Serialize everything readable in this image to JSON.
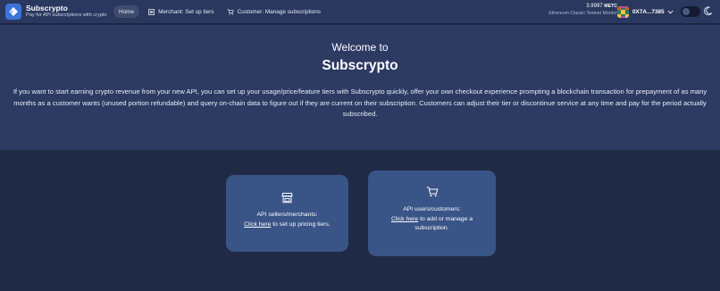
{
  "header": {
    "brand_name": "Subscrypto",
    "brand_tagline": "Pay for API subscriptions with crypto",
    "nav": [
      {
        "label": "Home",
        "icon": "none"
      },
      {
        "label": "Merchant: Set up tiers",
        "icon": "list-icon"
      },
      {
        "label": "Customer: Manage subscriptions",
        "icon": "cart-icon"
      }
    ],
    "balance_amount": "3.9997",
    "balance_unit": "METC",
    "network": "Ethereum Classic Testnet Mordor",
    "address": "0X7A...7385"
  },
  "hero": {
    "welcome": "Welcome to",
    "title": "Subscrypto",
    "description": "If you want to start earning crypto revenue from your new API, you can set up your usage/price/feature tiers with Subscrypto quickly, offer your own checkout experience prompting a blockchain transaction for prepayment of as many months as a customer wants (unused portion refundable) and query on-chain data to figure out if they are current on their subscription. Customers can adjust their tier or discontinue service at any time and pay for the period actually subscribed."
  },
  "cards": {
    "merchant": {
      "icon": "store-icon",
      "heading": "API sellers/merchants:",
      "link": "Click here",
      "rest": " to set up pricing tiers."
    },
    "customer": {
      "icon": "cart-icon",
      "heading": "API users/customers:",
      "link": "Click here",
      "rest": " to add or manage a subscription."
    }
  },
  "colors": {
    "header_bg": "#2a385f",
    "hero_bg": "#2d3b63",
    "page_bg": "#202a45",
    "card_bg": "#395487",
    "accent": "#3b74d6"
  }
}
